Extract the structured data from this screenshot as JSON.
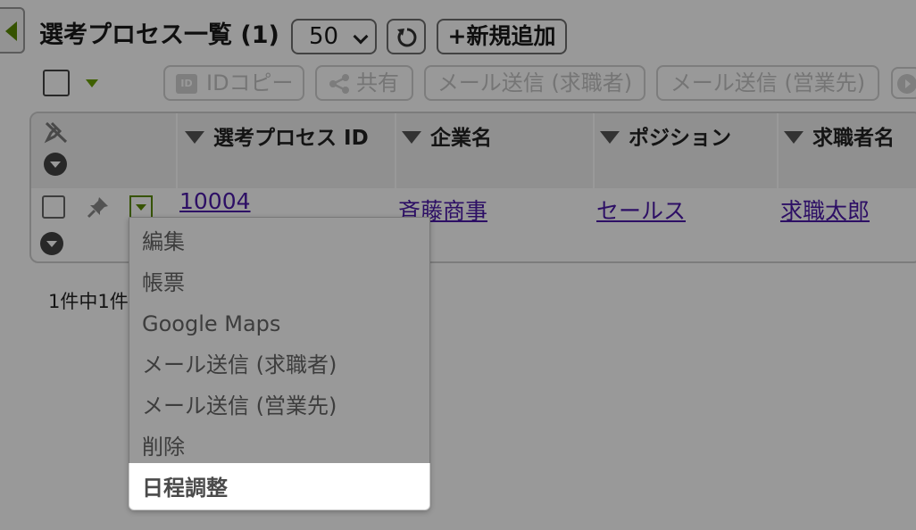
{
  "header": {
    "title": "選考プロセス一覧",
    "count": "(1)",
    "per_page": "50",
    "new_button": "+新規追加"
  },
  "toolbar": {
    "copy_id_icon": "ID",
    "copy_id": "IDコピー",
    "share": "共有",
    "mail_candidate": "メール送信 (求職者)",
    "mail_client": "メール送信 (営業先)"
  },
  "table": {
    "columns": [
      "選考プロセス ID",
      "企業名",
      "ポジション",
      "求職者名"
    ],
    "rows": [
      {
        "id": "10004",
        "company": "斉藤商事",
        "position": "セールス",
        "candidate": "求職太郎"
      }
    ]
  },
  "pager": {
    "text": "1件中1件"
  },
  "row_menu": {
    "items": [
      "編集",
      "帳票",
      "Google Maps",
      "メール送信 (求職者)",
      "メール送信 (営業先)",
      "削除",
      "日程調整"
    ],
    "highlighted_item": "日程調整"
  },
  "colors": {
    "accent_green": "#5a8a00",
    "link_purple": "#4b1aa8",
    "overlay": "rgba(0,0,0,0.40)"
  },
  "icons": [
    "back-arrow-icon",
    "refresh-icon",
    "share-icon",
    "pin-off-icon",
    "pin-icon",
    "chevron-down-icon"
  ]
}
